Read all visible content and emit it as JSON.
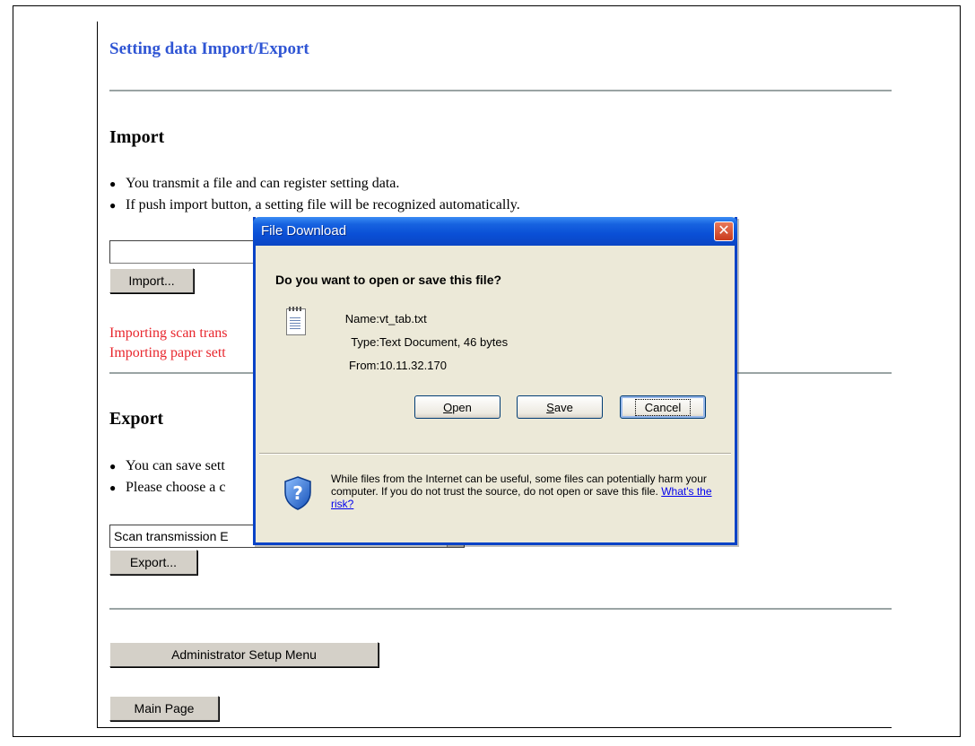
{
  "page": {
    "title": "Setting data Import/Export"
  },
  "import_section": {
    "heading": "Import",
    "bullets": [
      "You transmit a file and can register setting data.",
      "If push import button, a setting file will be recognized automatically."
    ],
    "file_input_value": "",
    "import_button_label": "Import...",
    "messages": [
      "Importing scan trans",
      "Importing paper sett"
    ],
    "message_color": "#e8262d"
  },
  "export_section": {
    "heading": "Export",
    "bullets": [
      "You can save sett",
      "Please choose a c"
    ],
    "selected_option": "Scan transmission E",
    "export_button_label": "Export..."
  },
  "footer_buttons": {
    "admin_menu_label": "Administrator Setup Menu",
    "main_page_label": "Main Page"
  },
  "dialog": {
    "title": "File Download",
    "close_symbol": "✕",
    "question": "Do you want to open or save this file?",
    "file_icon": "text-file-icon",
    "info": {
      "name_label": "Name:",
      "name_value": "vt_tab.txt",
      "type_label": "Type:",
      "type_value": "Text Document, 46 bytes",
      "from_label": "From:",
      "from_value": "10.11.32.170"
    },
    "buttons": {
      "open": {
        "accel": "O",
        "rest": "pen"
      },
      "save": {
        "accel": "S",
        "rest": "ave"
      },
      "cancel": "Cancel"
    },
    "warning_icon": "shield-question-icon",
    "warning_text": "While files from the Internet can be useful, some files can potentially harm your computer. If you do not trust the source, do not open or save this file.",
    "risk_link": "What's the risk?"
  },
  "colors": {
    "title_blue": "#2f55d4",
    "dialog_titlebar": "#0a4fd6",
    "dialog_body": "#ece9d8"
  }
}
